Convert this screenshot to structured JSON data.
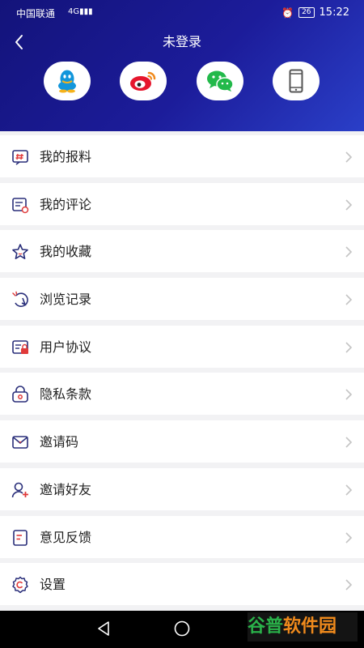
{
  "status_bar": {
    "carrier": "中国联通",
    "network": "4G",
    "battery": "26",
    "time": "15:22"
  },
  "header": {
    "title": "未登录"
  },
  "social_logins": [
    {
      "icon": "qq-icon",
      "color": "#1296db"
    },
    {
      "icon": "weibo-icon",
      "color": "#e6162d"
    },
    {
      "icon": "wechat-icon",
      "color": "#22b94a"
    },
    {
      "icon": "phone-icon",
      "color": "#555555"
    }
  ],
  "menu": [
    {
      "label": "我的报料",
      "icon": "report-icon"
    },
    {
      "label": "我的评论",
      "icon": "comment-icon"
    },
    {
      "label": "我的收藏",
      "icon": "star-icon"
    },
    {
      "label": "浏览记录",
      "icon": "history-icon"
    },
    {
      "label": "用户协议",
      "icon": "agreement-icon"
    },
    {
      "label": "隐私条款",
      "icon": "privacy-icon"
    },
    {
      "label": "邀请码",
      "icon": "invite-code-icon"
    },
    {
      "label": "邀请好友",
      "icon": "invite-friend-icon"
    },
    {
      "label": "意见反馈",
      "icon": "feedback-icon"
    },
    {
      "label": "设置",
      "icon": "settings-icon"
    }
  ],
  "watermark": {
    "text_a": "谷普",
    "text_b": "软件园",
    "color_a": "#2ab24a",
    "color_b": "#f08a1c"
  },
  "colors": {
    "header_start": "#13137a",
    "header_end": "#2a3fc8",
    "icon_navy": "#2a2f7a",
    "icon_red": "#e03a3a",
    "chevron": "#c4c4c4"
  }
}
